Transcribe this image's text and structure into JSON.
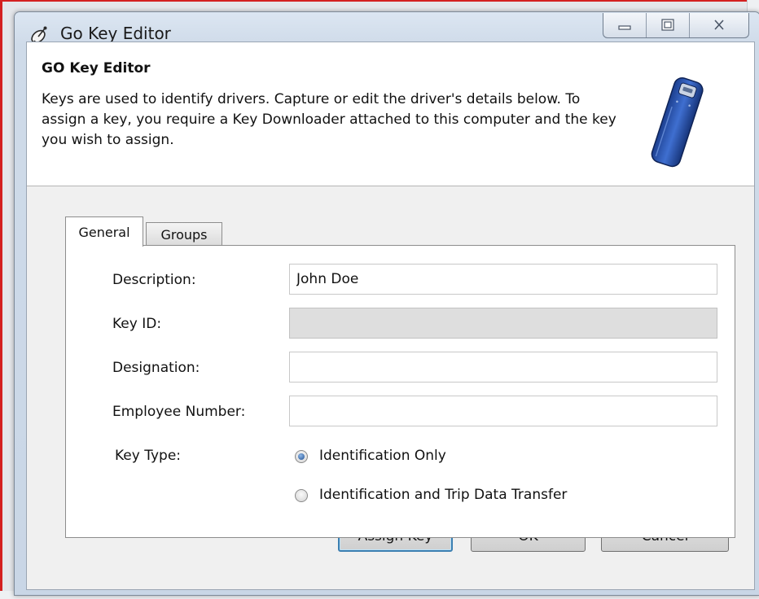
{
  "window": {
    "title": "Go Key Editor",
    "icon": "satellite-dish-icon",
    "caption_buttons": [
      "minimize-icon",
      "maximize-icon",
      "close-icon"
    ]
  },
  "header": {
    "title": "GO Key Editor",
    "description": "Keys are used to identify drivers. Capture or edit the driver's details below. To assign a key, you require a Key Downloader attached to this computer and the key you wish to assign.",
    "graphic": "usb-key-icon"
  },
  "tabs": [
    {
      "label": "General",
      "selected": true
    },
    {
      "label": "Groups",
      "selected": false
    }
  ],
  "form": {
    "description_label": "Description:",
    "description_value": "John Doe",
    "key_id_label": "Key ID:",
    "key_id_value": "",
    "designation_label": "Designation:",
    "designation_value": "",
    "employee_number_label": "Employee Number:",
    "employee_number_value": "",
    "key_type_label": "Key Type:",
    "key_type_options": [
      {
        "label": "Identification Only",
        "checked": true
      },
      {
        "label": "Identification and Trip Data Transfer",
        "checked": false
      }
    ]
  },
  "buttons": {
    "assign_key": "Assign Key",
    "ok": "OK",
    "cancel": "Cancel"
  },
  "colors": {
    "accent": "#3c7fb1",
    "frame_red": "#d42020"
  }
}
